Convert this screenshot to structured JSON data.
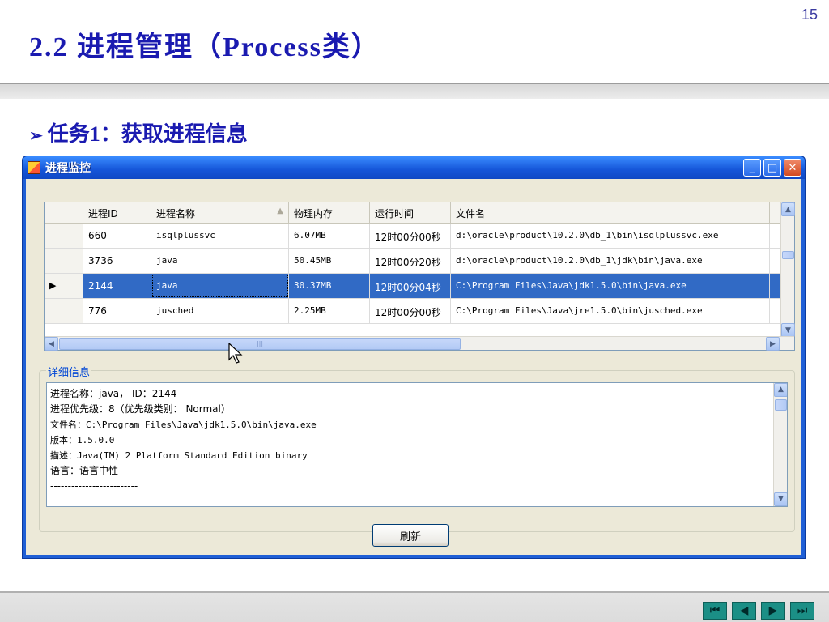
{
  "slide": {
    "page_number": "15",
    "title": "2.2 进程管理（Process类）",
    "task": "任务1：获取进程信息"
  },
  "window": {
    "title": "进程监控",
    "controls": {
      "minimize": "_",
      "maximize": "□",
      "close": "✕"
    }
  },
  "grid": {
    "columns": [
      "进程ID",
      "进程名称",
      "物理内存",
      "运行时间",
      "文件名"
    ],
    "sort_indicator": "▲",
    "rows": [
      {
        "marker": "",
        "id": "660",
        "name": "isqlplussvc",
        "memory": "6.07MB",
        "runtime": "12时00分00秒",
        "file": "d:\\oracle\\product\\10.2.0\\db_1\\bin\\isqlplussvc.exe"
      },
      {
        "marker": "",
        "id": "3736",
        "name": "java",
        "memory": "50.45MB",
        "runtime": "12时00分20秒",
        "file": "d:\\oracle\\product\\10.2.0\\db_1\\jdk\\bin\\java.exe"
      },
      {
        "marker": "▶",
        "id": "2144",
        "name": "java",
        "memory": "30.37MB",
        "runtime": "12时00分04秒",
        "file": "C:\\Program Files\\Java\\jdk1.5.0\\bin\\java.exe"
      },
      {
        "marker": "",
        "id": "776",
        "name": "jusched",
        "memory": "2.25MB",
        "runtime": "12时00分00秒",
        "file": "C:\\Program Files\\Java\\jre1.5.0\\bin\\jusched.exe"
      }
    ],
    "selected_row": 2,
    "scroll": {
      "up": "▲",
      "down": "▼",
      "left": "◀",
      "right": "▶",
      "thumb_grip": "|||"
    }
  },
  "details": {
    "label": "详细信息",
    "lines": [
      "进程名称：java，  ID：2144",
      "进程优先级：8（优先级类别： Normal）",
      "文件名：C:\\Program Files\\Java\\jdk1.5.0\\bin\\java.exe",
      "版本：1.5.0.0",
      "描述：Java(TM) 2 Platform Standard Edition binary",
      "语言：语言中性",
      "-------------------------"
    ]
  },
  "refresh_label": "刷新",
  "nav": {
    "first": "⏮",
    "prev": "◀",
    "next": "▶",
    "last": "⏭"
  },
  "colors": {
    "title_blue": "#1a1ab0",
    "selection": "#316ac5",
    "titlebar": "#1555d8",
    "nav_teal": "#1b8f86"
  }
}
